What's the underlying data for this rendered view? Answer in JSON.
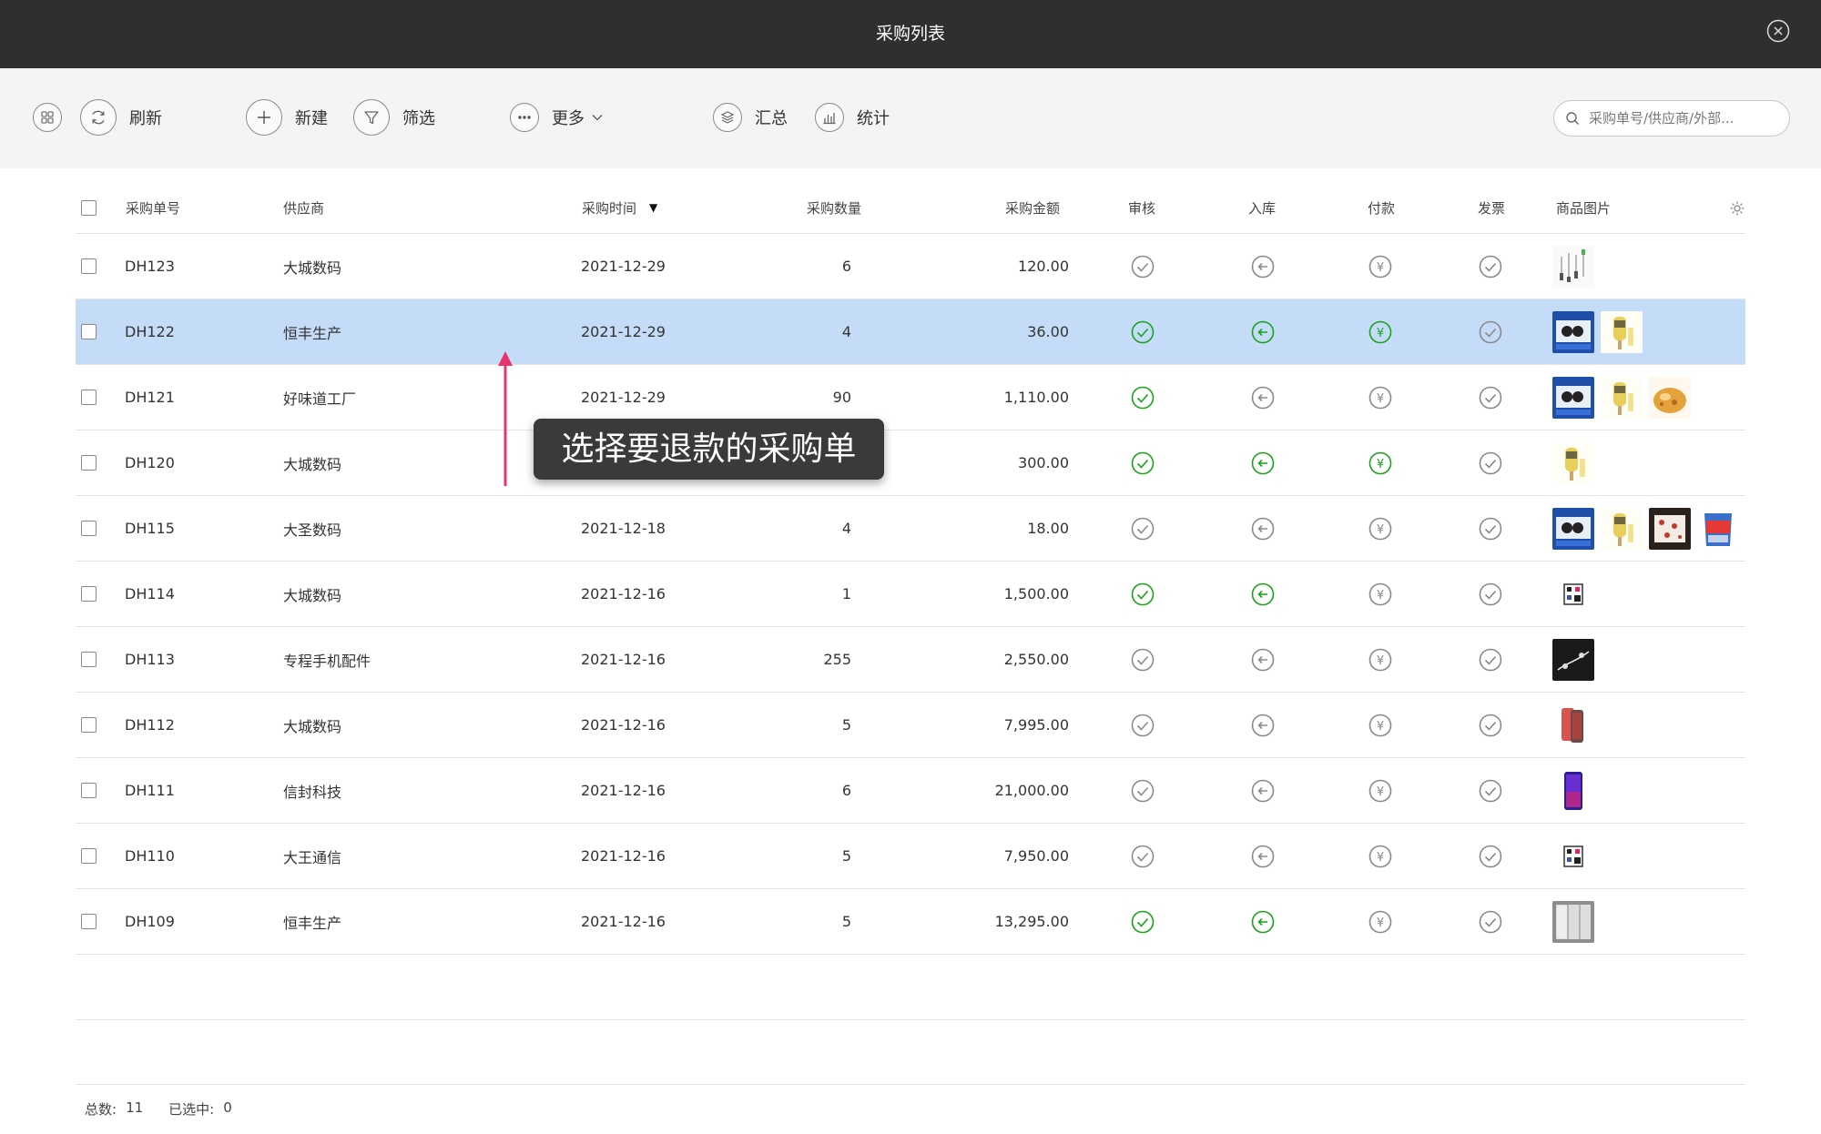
{
  "window": {
    "title": "采购列表"
  },
  "toolbar": {
    "refresh_label": "刷新",
    "new_label": "新建",
    "filter_label": "筛选",
    "more_label": "更多",
    "summary_label": "汇总",
    "stats_label": "统计",
    "search_placeholder": "采购单号/供应商/外部..."
  },
  "table": {
    "columns": [
      "采购单号",
      "供应商",
      "采购时间",
      "采购数量",
      "采购金额",
      "审核",
      "入库",
      "付款",
      "发票",
      "商品图片"
    ],
    "sort_indicator": "▼",
    "rows": [
      {
        "id": "DH123",
        "supplier": "大城数码",
        "date": "2021-12-29",
        "qty": "6",
        "amount": "120.00",
        "audit": false,
        "stock": false,
        "pay": false,
        "invoice": false,
        "images": [
          "cables"
        ],
        "selected": false
      },
      {
        "id": "DH122",
        "supplier": "恒丰生产",
        "date": "2021-12-29",
        "qty": "4",
        "amount": "36.00",
        "audit": true,
        "stock": true,
        "pay": true,
        "invoice": false,
        "images": [
          "box-blue",
          "popsicle"
        ],
        "selected": true
      },
      {
        "id": "DH121",
        "supplier": "好味道工厂",
        "date": "2021-12-29",
        "qty": "90",
        "amount": "1,110.00",
        "audit": true,
        "stock": false,
        "pay": false,
        "invoice": false,
        "images": [
          "box-blue",
          "popsicle",
          "pastry"
        ],
        "selected": false
      },
      {
        "id": "DH120",
        "supplier": "大城数码",
        "date": "",
        "qty": "",
        "amount": "300.00",
        "audit": true,
        "stock": true,
        "pay": true,
        "invoice": false,
        "images": [
          "popsicle"
        ],
        "selected": false
      },
      {
        "id": "DH115",
        "supplier": "大圣数码",
        "date": "2021-12-18",
        "qty": "4",
        "amount": "18.00",
        "audit": false,
        "stock": false,
        "pay": false,
        "invoice": false,
        "images": [
          "box-blue",
          "popsicle",
          "dark-food",
          "snack-bag"
        ],
        "selected": false
      },
      {
        "id": "DH114",
        "supplier": "大城数码",
        "date": "2021-12-16",
        "qty": "1",
        "amount": "1,500.00",
        "audit": true,
        "stock": true,
        "pay": false,
        "invoice": false,
        "images": [
          "qr"
        ],
        "selected": false
      },
      {
        "id": "DH113",
        "supplier": "专程手机配件",
        "date": "2021-12-16",
        "qty": "255",
        "amount": "2,550.00",
        "audit": false,
        "stock": false,
        "pay": false,
        "invoice": false,
        "images": [
          "earphone"
        ],
        "selected": false
      },
      {
        "id": "DH112",
        "supplier": "大城数码",
        "date": "2021-12-16",
        "qty": "5",
        "amount": "7,995.00",
        "audit": false,
        "stock": false,
        "pay": false,
        "invoice": false,
        "images": [
          "phone-red"
        ],
        "selected": false
      },
      {
        "id": "DH111",
        "supplier": "信封科技",
        "date": "2021-12-16",
        "qty": "6",
        "amount": "21,000.00",
        "audit": false,
        "stock": false,
        "pay": false,
        "invoice": false,
        "images": [
          "phone-purple"
        ],
        "selected": false
      },
      {
        "id": "DH110",
        "supplier": "大王通信",
        "date": "2021-12-16",
        "qty": "5",
        "amount": "7,950.00",
        "audit": false,
        "stock": false,
        "pay": false,
        "invoice": false,
        "images": [
          "qr"
        ],
        "selected": false
      },
      {
        "id": "DH109",
        "supplier": "恒丰生产",
        "date": "2021-12-16",
        "qty": "5",
        "amount": "13,295.00",
        "audit": true,
        "stock": true,
        "pay": false,
        "invoice": false,
        "images": [
          "cabinet"
        ],
        "selected": false
      }
    ]
  },
  "footer": {
    "total_label": "总数:",
    "total_value": "11",
    "selected_label": "已选中:",
    "selected_value": "0"
  },
  "annotation": {
    "text": "选择要退款的采购单"
  },
  "colors": {
    "active_green": "#19a319",
    "inactive_gray": "#8a8a8a",
    "selected_row": "#c5dcf8",
    "arrow": "#e8336e"
  }
}
